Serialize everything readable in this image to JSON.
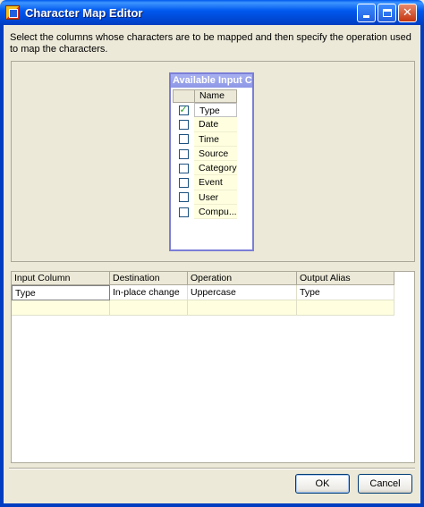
{
  "window": {
    "title": "Character Map Editor"
  },
  "instructions": "Select the columns whose characters are to be mapped and then specify the operation used to map the characters.",
  "available_columns": {
    "title": "Available Input C...",
    "header": "Name",
    "rows": [
      {
        "name": "Type",
        "checked": true
      },
      {
        "name": "Date",
        "checked": false
      },
      {
        "name": "Time",
        "checked": false
      },
      {
        "name": "Source",
        "checked": false
      },
      {
        "name": "Category",
        "checked": false
      },
      {
        "name": "Event",
        "checked": false
      },
      {
        "name": "User",
        "checked": false
      },
      {
        "name": "Compu...",
        "checked": false
      }
    ]
  },
  "mapping_table": {
    "headers": [
      "Input Column",
      "Destination",
      "Operation",
      "Output Alias"
    ],
    "rows": [
      [
        "Type",
        "In-place change",
        "Uppercase",
        "Type"
      ]
    ]
  },
  "buttons": {
    "ok": "OK",
    "cancel": "Cancel"
  },
  "colors": {
    "titlebar": "#0058ee",
    "panel_bg": "#ece9d8",
    "new_row": "#ffffe0",
    "column_box_border": "#7b7ed6"
  }
}
